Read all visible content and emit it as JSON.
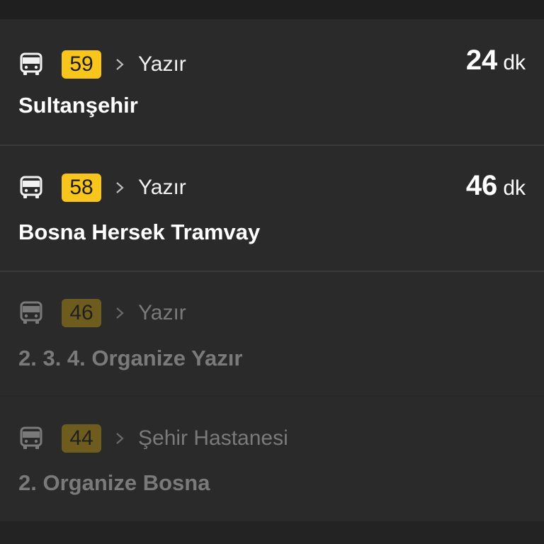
{
  "routes": [
    {
      "number": "59",
      "direction": "Yazır",
      "stop": "Sultanşehir",
      "eta_value": "24",
      "eta_unit": "dk",
      "active": true
    },
    {
      "number": "58",
      "direction": "Yazır",
      "stop": "Bosna Hersek Tramvay",
      "eta_value": "46",
      "eta_unit": "dk",
      "active": true
    },
    {
      "number": "46",
      "direction": "Yazır",
      "stop": "2. 3. 4.  Organize Yazır",
      "active": false
    },
    {
      "number": "44",
      "direction": "Şehir Hastanesi",
      "stop": "2. Organize Bosna",
      "active": false
    }
  ],
  "colors": {
    "badge_active": "#f7c51c",
    "badge_inactive": "#6e5c1f",
    "text_active": "#ffffff",
    "text_inactive": "#7a7a7a"
  },
  "icons": {
    "route_icon": "bus-icon",
    "separator_icon": "chevron-right-icon"
  }
}
